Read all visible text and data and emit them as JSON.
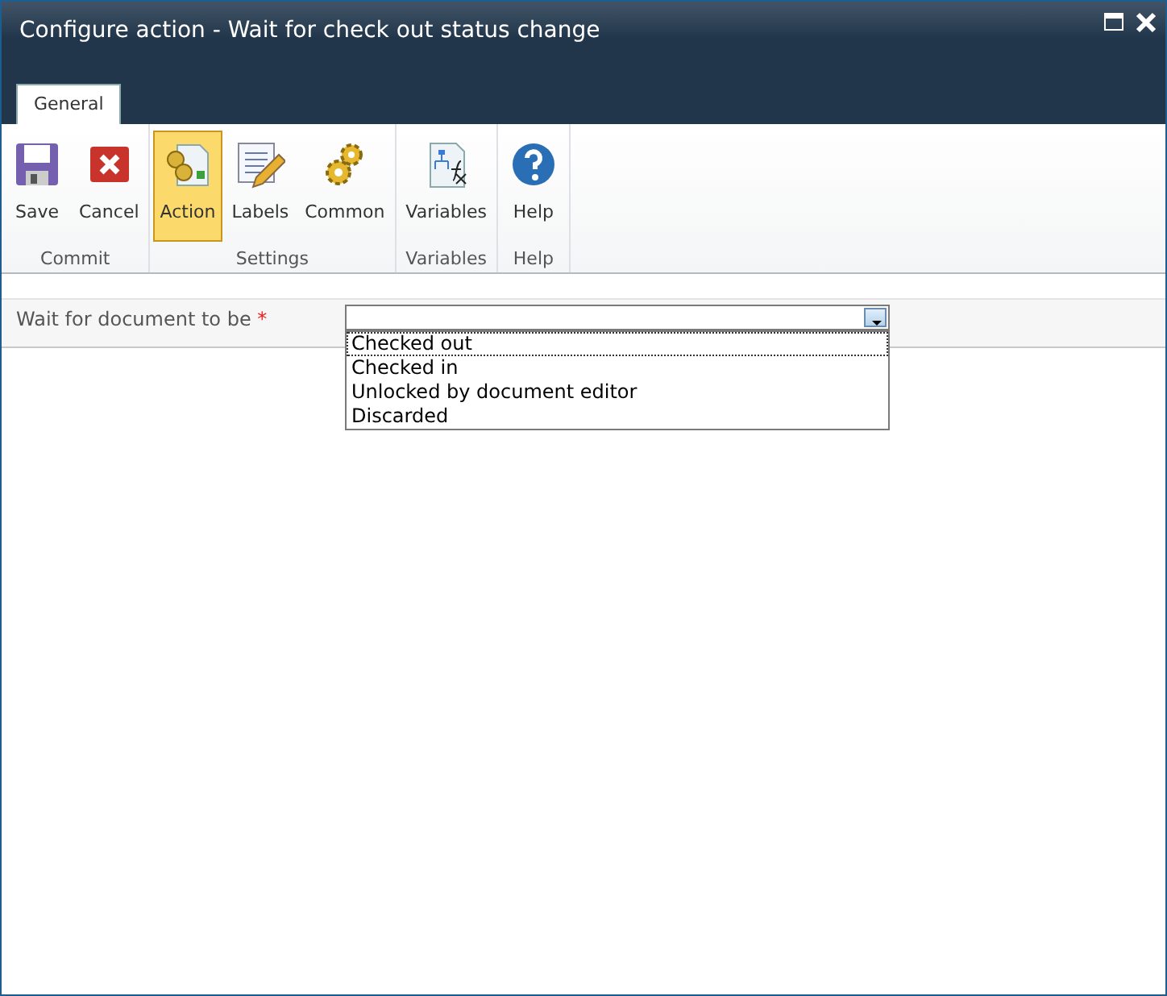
{
  "window": {
    "title": "Configure action - Wait for check out status change"
  },
  "tabs": [
    {
      "label": "General",
      "selected": true
    }
  ],
  "ribbon": {
    "groups": [
      {
        "label": "Commit",
        "buttons": [
          {
            "label": "Save",
            "kind": "save",
            "selected": false
          },
          {
            "label": "Cancel",
            "kind": "cancel",
            "selected": false
          }
        ]
      },
      {
        "label": "Settings",
        "buttons": [
          {
            "label": "Action",
            "kind": "action",
            "selected": true
          },
          {
            "label": "Labels",
            "kind": "labels",
            "selected": false
          },
          {
            "label": "Common",
            "kind": "common",
            "selected": false
          }
        ]
      },
      {
        "label": "Variables",
        "buttons": [
          {
            "label": "Variables",
            "kind": "variables",
            "selected": false
          }
        ]
      },
      {
        "label": "Help",
        "buttons": [
          {
            "label": "Help",
            "kind": "help",
            "selected": false
          }
        ]
      }
    ]
  },
  "form": {
    "fields": [
      {
        "label": "Wait for document to be",
        "required_mark": "*",
        "expanded": true,
        "options": [
          {
            "label": "Checked out",
            "selected": true
          },
          {
            "label": "Checked in",
            "selected": false
          },
          {
            "label": "Unlocked by document editor",
            "selected": false
          },
          {
            "label": "Discarded",
            "selected": false
          }
        ]
      }
    ]
  }
}
